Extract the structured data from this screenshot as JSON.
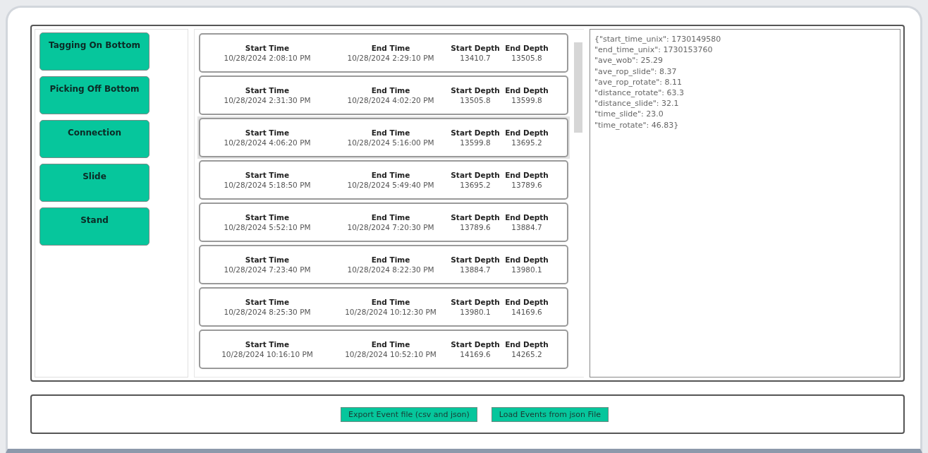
{
  "event_types": [
    {
      "label": "Tagging On Bottom"
    },
    {
      "label": "Picking Off Bottom"
    },
    {
      "label": "Connection"
    },
    {
      "label": "Slide"
    },
    {
      "label": "Stand"
    }
  ],
  "events": [
    {
      "headings": [
        "Start Time",
        "End Time",
        "Start Depth",
        "End Depth"
      ],
      "start_time": "10/28/2024 2:08:10 PM",
      "end_time": "10/28/2024 2:29:10 PM",
      "start_depth": "13410.7",
      "end_depth": "13505.8",
      "selected": false
    },
    {
      "headings": [
        "Start Time",
        "End Time",
        "Start Depth",
        "End Depth"
      ],
      "start_time": "10/28/2024 2:31:30 PM",
      "end_time": "10/28/2024 4:02:20 PM",
      "start_depth": "13505.8",
      "end_depth": "13599.8",
      "selected": false
    },
    {
      "headings": [
        "Start Time",
        "End Time",
        "Start Depth",
        "End Depth"
      ],
      "start_time": "10/28/2024 4:06:20 PM",
      "end_time": "10/28/2024 5:16:00 PM",
      "start_depth": "13599.8",
      "end_depth": "13695.2",
      "selected": true
    },
    {
      "headings": [
        "Start Time",
        "End Time",
        "Start Depth",
        "End Depth"
      ],
      "start_time": "10/28/2024 5:18:50 PM",
      "end_time": "10/28/2024 5:49:40 PM",
      "start_depth": "13695.2",
      "end_depth": "13789.6",
      "selected": false
    },
    {
      "headings": [
        "Start Time",
        "End Time",
        "Start Depth",
        "End Depth"
      ],
      "start_time": "10/28/2024 5:52:10 PM",
      "end_time": "10/28/2024 7:20:30 PM",
      "start_depth": "13789.6",
      "end_depth": "13884.7",
      "selected": false
    },
    {
      "headings": [
        "Start Time",
        "End Time",
        "Start Depth",
        "End Depth"
      ],
      "start_time": "10/28/2024 7:23:40 PM",
      "end_time": "10/28/2024 8:22:30 PM",
      "start_depth": "13884.7",
      "end_depth": "13980.1",
      "selected": false
    },
    {
      "headings": [
        "Start Time",
        "End Time",
        "Start Depth",
        "End Depth"
      ],
      "start_time": "10/28/2024 8:25:30 PM",
      "end_time": "10/28/2024 10:12:30 PM",
      "start_depth": "13980.1",
      "end_depth": "14169.6",
      "selected": false
    },
    {
      "headings": [
        "Start Time",
        "End Time",
        "Start Depth",
        "End Depth"
      ],
      "start_time": "10/28/2024 10:16:10 PM",
      "end_time": "10/28/2024 10:52:10 PM",
      "start_depth": "14169.6",
      "end_depth": "14265.2",
      "selected": false
    }
  ],
  "details": [
    "{\"start_time_unix\": 1730149580",
    "\"end_time_unix\": 1730153760",
    "\"ave_wob\": 25.29",
    "\"ave_rop_slide\": 8.37",
    "\"ave_rop_rotate\": 8.11",
    "\"distance_rotate\": 63.3",
    "\"distance_slide\": 32.1",
    "\"time_slide\": 23.0",
    "\"time_rotate\": 46.83}"
  ],
  "actions": [
    {
      "label": "Export Event file (csv and json)"
    },
    {
      "label": "Load Events from json File"
    }
  ]
}
